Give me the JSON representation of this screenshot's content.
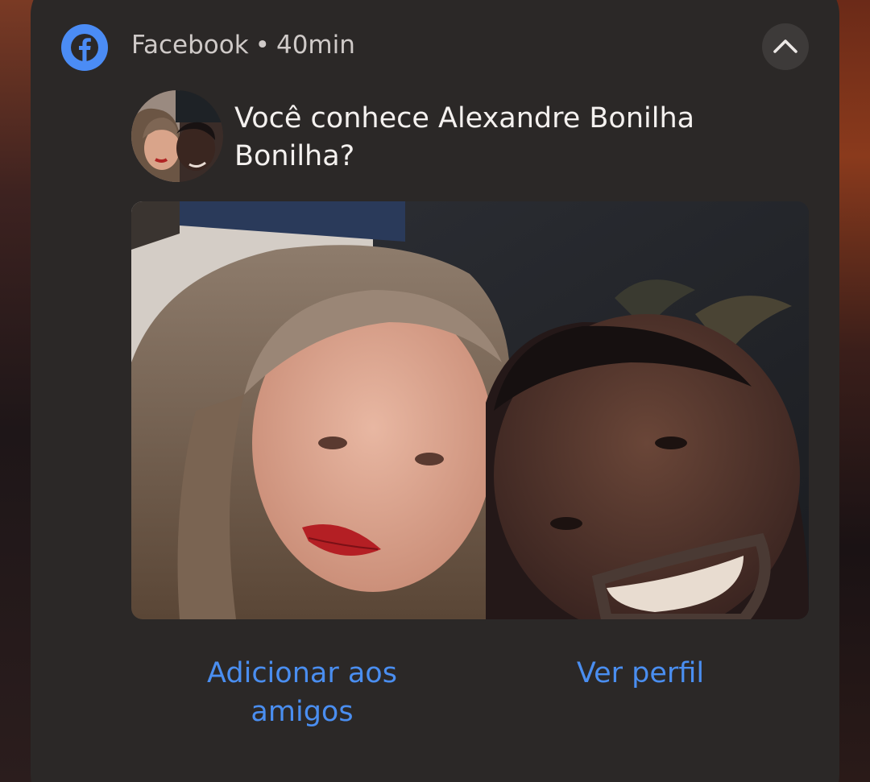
{
  "notification": {
    "app_name": "Facebook",
    "separator": "•",
    "time": "40min",
    "title": "Você conhece Alexandre Bonilha Bonilha?",
    "actions": {
      "add_friend": "Adicionar aos amigos",
      "view_profile": "Ver perfil"
    },
    "icons": {
      "app": "facebook-icon",
      "collapse": "chevron-up-icon"
    }
  },
  "colors": {
    "card_bg": "#2b2827",
    "action_text": "#4a8ef0",
    "facebook_blue": "#4b8cf5",
    "title_text": "#f4f1ef",
    "header_text": "#cfcac8"
  }
}
